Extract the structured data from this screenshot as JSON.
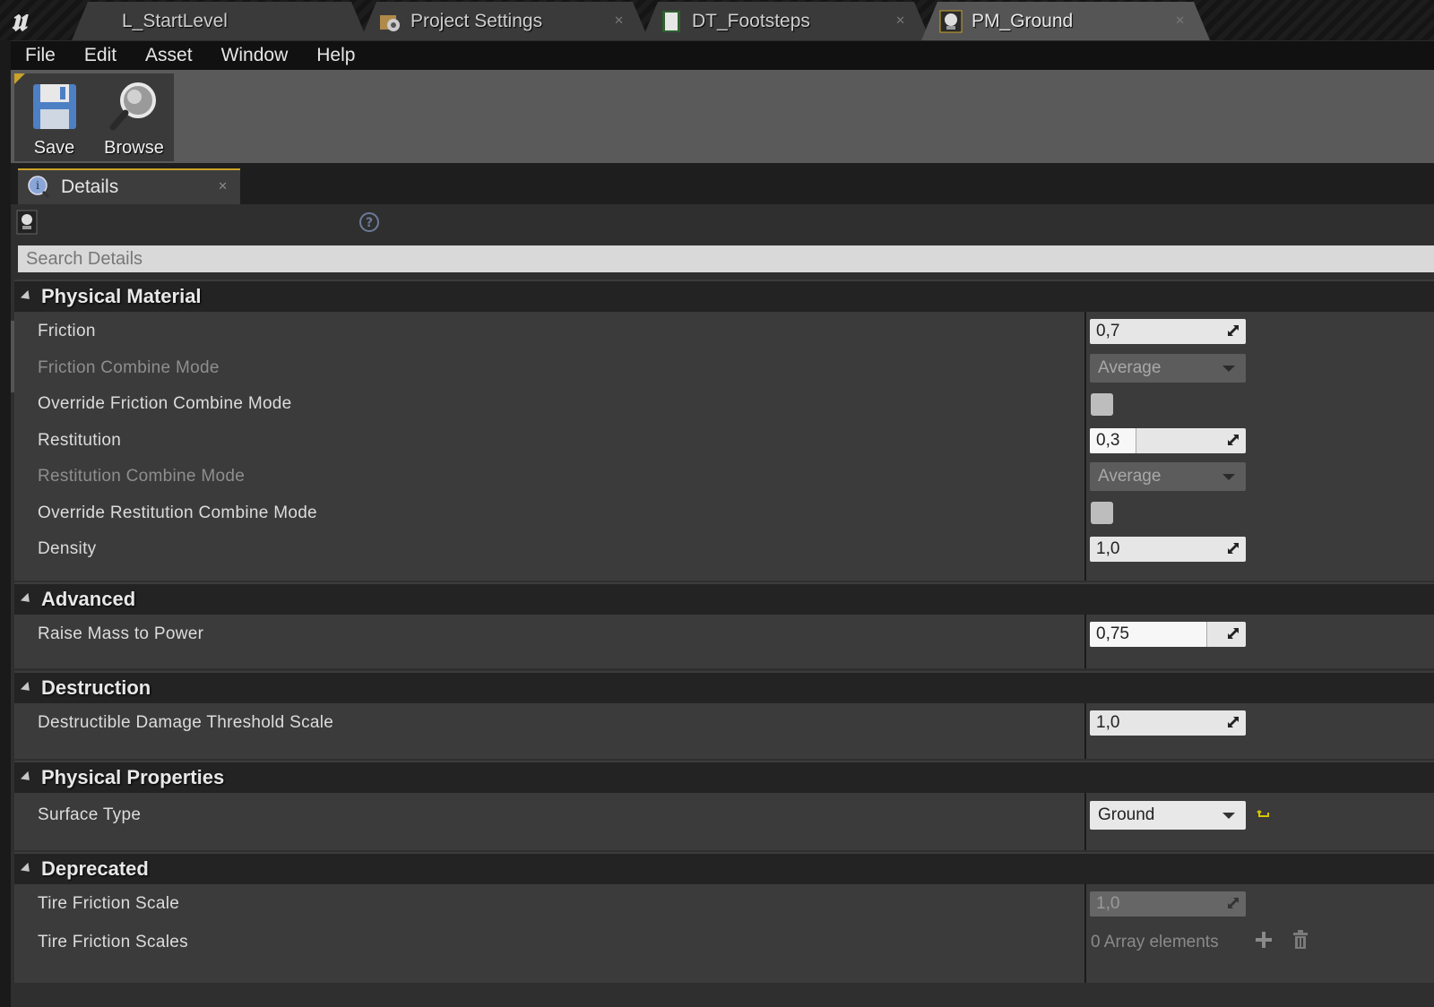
{
  "tabs": [
    {
      "label": "L_StartLevel",
      "icon": "ue-logo-icon"
    },
    {
      "label": "Project Settings",
      "icon": "settings-gear-icon"
    },
    {
      "label": "DT_Footsteps",
      "icon": "data-table-icon"
    },
    {
      "label": "PM_Ground",
      "icon": "physical-material-icon",
      "active": true
    }
  ],
  "menu": [
    "File",
    "Edit",
    "Asset",
    "Window",
    "Help"
  ],
  "toolbar": {
    "save_label": "Save",
    "browse_label": "Browse"
  },
  "details_tab": {
    "label": "Details"
  },
  "search": {
    "placeholder": "Search Details"
  },
  "colors": {
    "accent": "#c9a227",
    "panel_bg": "#3b3b3b",
    "header_bg": "#232323"
  },
  "categories": [
    {
      "title": "Physical Material",
      "rows": [
        {
          "name": "Friction",
          "type": "number",
          "value": "0,7"
        },
        {
          "name": "Friction Combine Mode",
          "type": "dropdown",
          "value": "Average",
          "disabled": true
        },
        {
          "name": "Override Friction Combine Mode",
          "type": "checkbox",
          "checked": false
        },
        {
          "name": "Restitution",
          "type": "slider",
          "value": "0,3",
          "fill_fraction": 0.3
        },
        {
          "name": "Restitution Combine Mode",
          "type": "dropdown",
          "value": "Average",
          "disabled": true
        },
        {
          "name": "Override Restitution Combine Mode",
          "type": "checkbox",
          "checked": false
        },
        {
          "name": "Density",
          "type": "number",
          "value": "1,0"
        }
      ]
    },
    {
      "title": "Advanced",
      "rows": [
        {
          "name": "Raise Mass to Power",
          "type": "slider",
          "value": "0,75",
          "fill_fraction": 0.75
        }
      ]
    },
    {
      "title": "Destruction",
      "rows": [
        {
          "name": "Destructible Damage Threshold Scale",
          "type": "number",
          "value": "1,0"
        }
      ]
    },
    {
      "title": "Physical Properties",
      "rows": [
        {
          "name": "Surface Type",
          "type": "dropdown",
          "value": "Ground",
          "disabled": false,
          "reset": true
        }
      ]
    },
    {
      "title": "Deprecated",
      "rows": [
        {
          "name": "Tire Friction Scale",
          "type": "number",
          "value": "1,0",
          "disabled": true
        },
        {
          "name": "Tire Friction Scales",
          "type": "array",
          "value": "0 Array elements"
        }
      ]
    }
  ]
}
